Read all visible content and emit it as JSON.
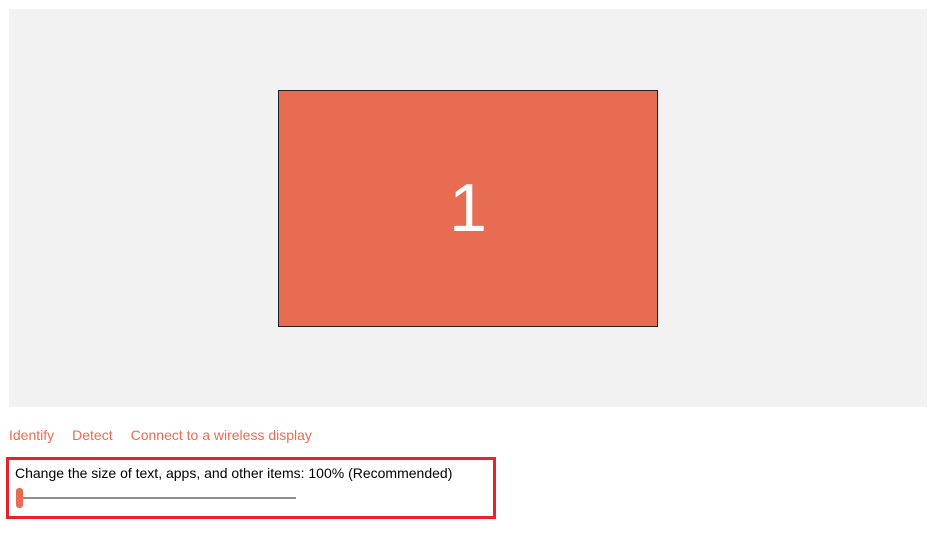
{
  "display_preview": {
    "monitor_number": "1"
  },
  "links": {
    "identify": "Identify",
    "detect": "Detect",
    "connect_wireless": "Connect to a wireless display"
  },
  "scale": {
    "label": "Change the size of text, apps, and other items: 100% (Recommended)"
  }
}
